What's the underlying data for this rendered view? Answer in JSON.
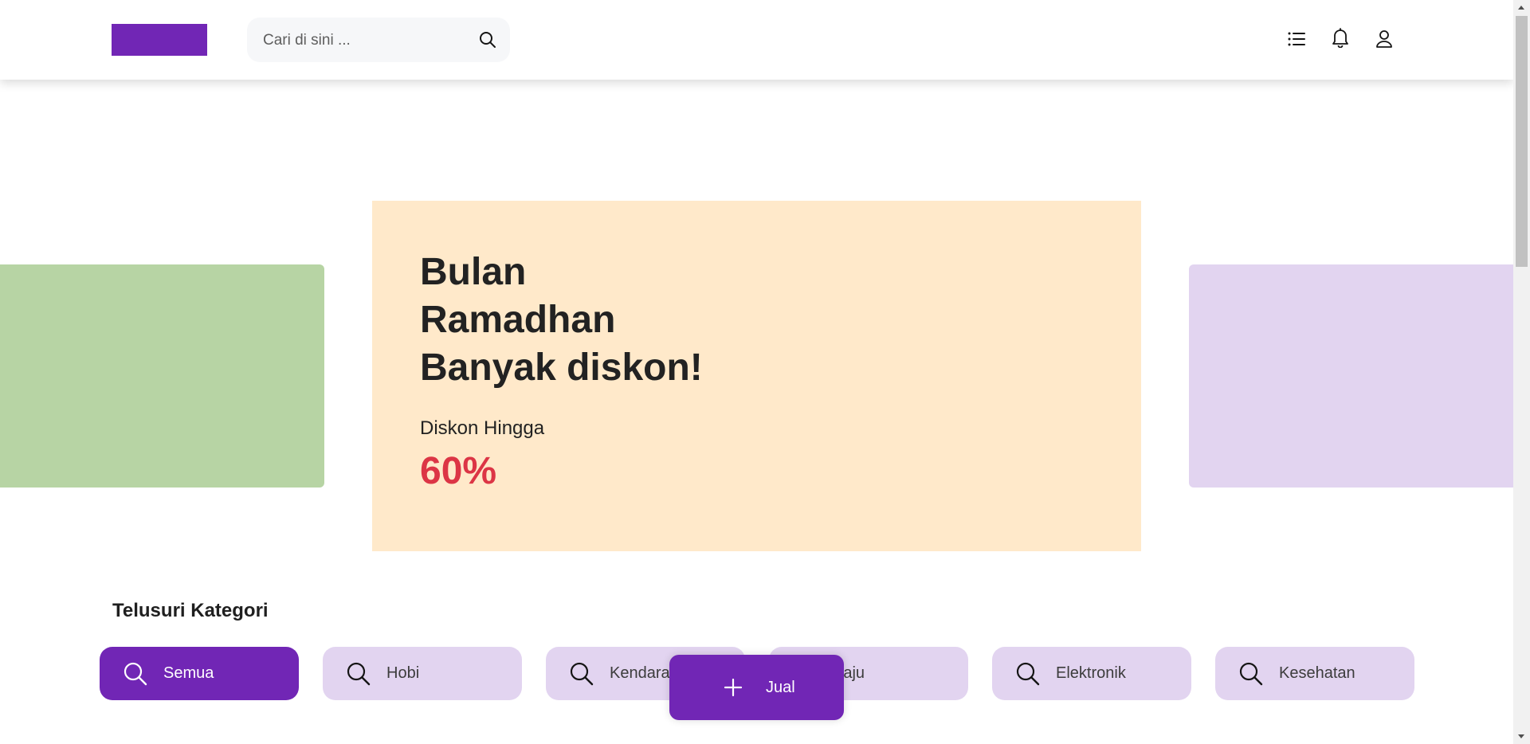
{
  "header": {
    "search_placeholder": "Cari di sini ...",
    "icons": [
      "list-icon",
      "bell-icon",
      "user-icon"
    ]
  },
  "banner": {
    "title_lines": [
      "Bulan",
      "Ramadhan",
      "Banyak diskon!"
    ],
    "subtitle": "Diskon Hingga",
    "percentage": "60%"
  },
  "categories": {
    "heading": "Telusuri Kategori",
    "items": [
      {
        "label": "Semua",
        "active": true
      },
      {
        "label": "Hobi",
        "active": false
      },
      {
        "label": "Kendaraan",
        "active": false
      },
      {
        "label": "Baju",
        "active": false
      },
      {
        "label": "Elektronik",
        "active": false
      },
      {
        "label": "Kesehatan",
        "active": false
      }
    ]
  },
  "sell_button": {
    "label": "Jual"
  },
  "colors": {
    "primary": "#7126b5",
    "primary_light": "#e2d4f0",
    "banner_bg": "#ffe9ca",
    "left_slide": "#b7d4a4",
    "discount_red": "#dc3545"
  }
}
